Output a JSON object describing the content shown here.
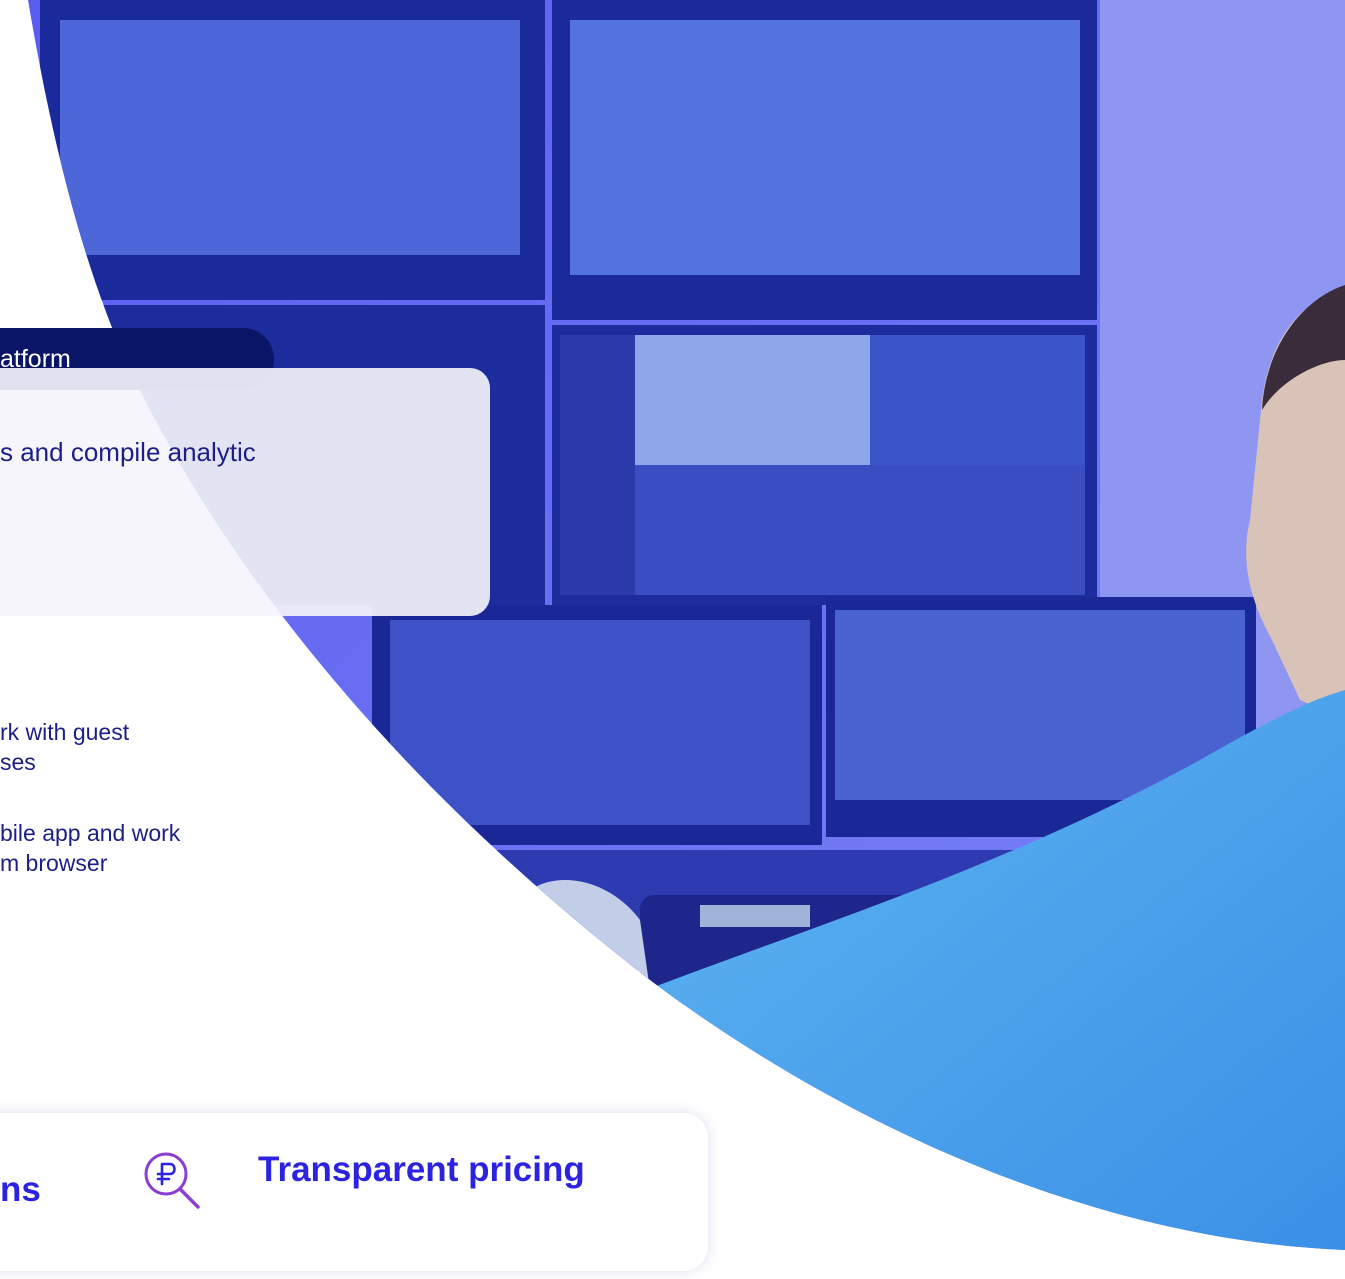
{
  "hero": {
    "image": "surveillance-operator-monitor-wall-photo",
    "overlay_color": "#4a4df0"
  },
  "platform_tag": {
    "text": "atform"
  },
  "feature_card": {
    "text": "s and compile analytic"
  },
  "bullets": [
    {
      "lines": [
        "rk with guest",
        "ses"
      ]
    },
    {
      "lines": [
        "bile app and work",
        "m browser"
      ]
    }
  ],
  "bottom_card": {
    "left_heading": "ns",
    "pricing_heading": "Transparent pricing",
    "pricing_icon": "ruble-magnifier-icon"
  },
  "colors": {
    "navy": "#0b1566",
    "text_dark_blue": "#1b1f86",
    "accent_blue": "#2b23e0",
    "icon_purple": "#8a3fd0"
  }
}
